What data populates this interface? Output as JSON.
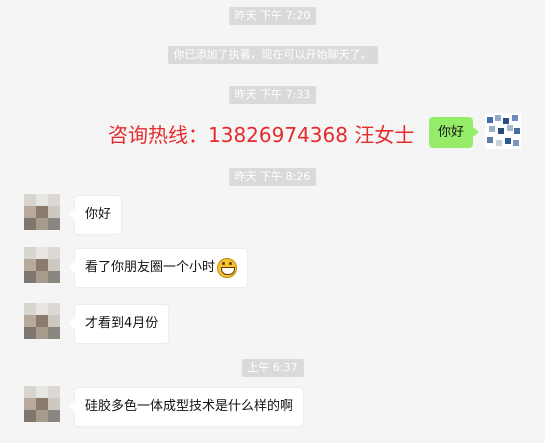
{
  "timestamps": [
    "昨天 下午 7:20",
    "昨天 下午 7:33",
    "昨天 下午 8:26",
    "上午 6:37"
  ],
  "system_notice": "你已添加了执著，现在可以开始聊天了。",
  "hotline": "咨询热线：13826974368  汪女士",
  "self_message": "你好",
  "messages": [
    "你好",
    "看了你朋友圈一个小时",
    "才看到4月份",
    "硅胶多色一体成型技术是什么样的啊"
  ],
  "colors": {
    "background": "#f5f5f5",
    "self_bubble": "#95ec69",
    "hotline_text": "#e52b2b",
    "timestamp_pill": "#dadada"
  },
  "icons": {
    "emoji": "grinning-face-icon",
    "contact_avatar": "pixelated-avatar",
    "self_avatar": "product-collage-avatar"
  }
}
